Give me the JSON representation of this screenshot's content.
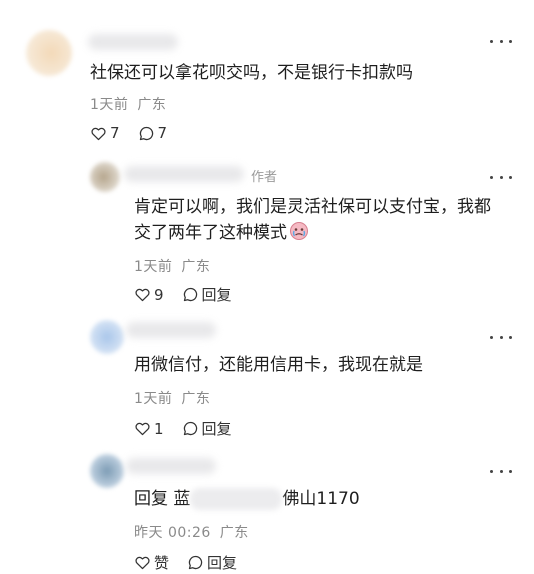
{
  "comments": [
    {
      "text": "社保还可以拿花呗交吗，不是银行卡扣款吗",
      "time": "1天前",
      "location": "广东",
      "likes": "7",
      "replies": "7"
    },
    {
      "author_tag": "作者",
      "line1": "肯定可以啊，我们是灵活社保可以支付宝，我都",
      "line2": "交了两年了这种模式",
      "time": "1天前",
      "location": "广东",
      "likes": "9",
      "reply_label": "回复"
    },
    {
      "text": "用微信付，还能用信用卡，我现在就是",
      "time": "1天前",
      "location": "广东",
      "likes": "1",
      "reply_label": "回复"
    },
    {
      "reply_prefix": "回复",
      "visible_start": "蓝",
      "visible_end": "佛山1170",
      "time": "昨天 00:26",
      "location": "广东",
      "like_label": "赞",
      "reply_label": "回复"
    }
  ],
  "colors": {
    "meta": "#8a8a8a",
    "text": "#1e1e1e",
    "background": "#ffffff"
  }
}
